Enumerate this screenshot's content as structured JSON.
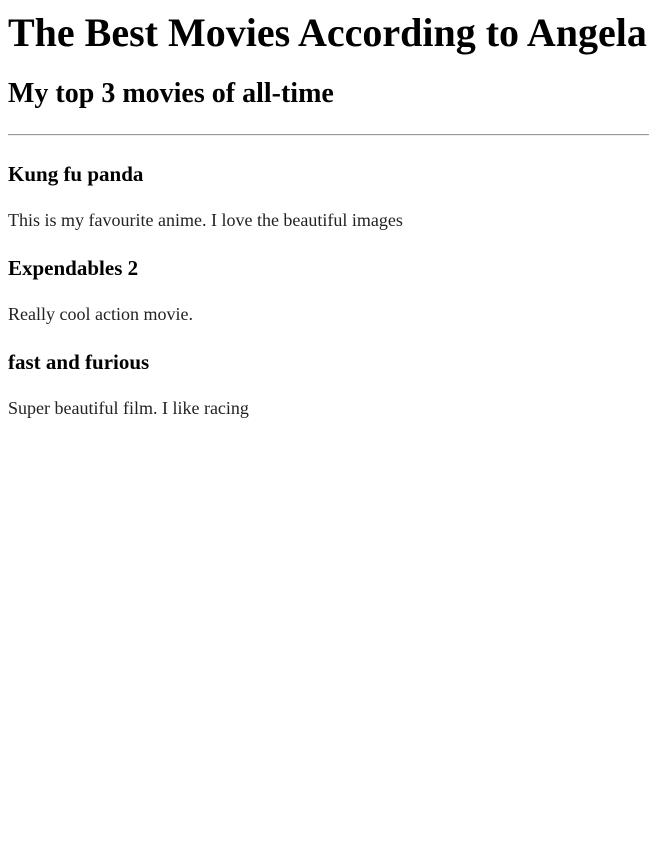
{
  "page": {
    "title": "The Best Movies According to Angela",
    "subtitle": "My top 3 movies of all-time"
  },
  "movies": [
    {
      "title": "Kung fu panda",
      "description": "This is my favourite anime. I love the beautiful images"
    },
    {
      "title": "Expendables 2",
      "description": "Really cool action movie."
    },
    {
      "title": "fast and furious",
      "description": "Super beautiful film. I like racing"
    }
  ]
}
